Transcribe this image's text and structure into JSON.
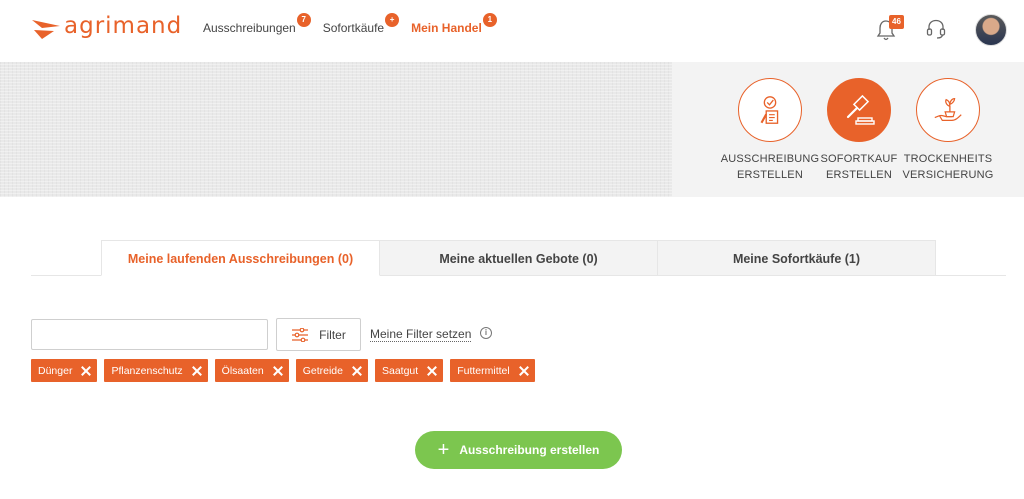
{
  "brand": {
    "name": "agrimand",
    "color": "#e8622a"
  },
  "nav": {
    "items": [
      {
        "label": "Ausschreibungen",
        "badge": "7",
        "active": false
      },
      {
        "label": "Sofortkäufe",
        "badge": "+",
        "active": false
      },
      {
        "label": "Mein Handel",
        "badge": "1",
        "active": true
      }
    ]
  },
  "header": {
    "notifications_count": "46",
    "icons": [
      "bell-icon",
      "headset-icon",
      "avatar"
    ]
  },
  "actions": [
    {
      "line1": "AUSSCHREIBUNG",
      "line2": "ERSTELLEN",
      "icon": "checklist-pen-icon",
      "filled": false
    },
    {
      "line1": "SOFORTKAUF",
      "line2": "ERSTELLEN",
      "icon": "gavel-icon",
      "filled": true
    },
    {
      "line1": "TROCKENHEITS",
      "line2": "VERSICHERUNG",
      "icon": "hand-plant-icon",
      "filled": false
    }
  ],
  "tabs": [
    {
      "label": "Meine laufenden Ausschreibungen (0)",
      "active": true
    },
    {
      "label": "Meine aktuellen Gebote (0)",
      "active": false
    },
    {
      "label": "Meine Sofortkäufe (1)",
      "active": false
    }
  ],
  "filter": {
    "search_value": "",
    "search_placeholder": "",
    "button_label": "Filter",
    "link_label": "Meine Filter setzen",
    "info": "i"
  },
  "chips": [
    "Dünger",
    "Pflanzenschutz",
    "Ölsaaten",
    "Getreide",
    "Saatgut",
    "Futtermittel"
  ],
  "cta": {
    "label": "Ausschreibung erstellen",
    "plus": "+",
    "color": "#7cc64f"
  }
}
